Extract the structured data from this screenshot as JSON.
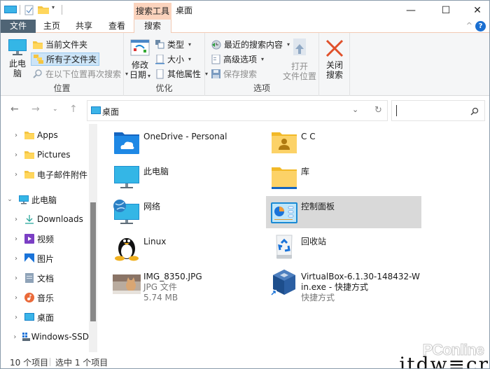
{
  "titlebar": {
    "context_tab": "搜索工具",
    "title": "桌面",
    "minimize": "—",
    "maximize": "☐",
    "close": "✕"
  },
  "tabs": [
    {
      "label": "文件"
    },
    {
      "label": "主页"
    },
    {
      "label": "共享"
    },
    {
      "label": "查看"
    },
    {
      "label": "搜索",
      "active": true
    }
  ],
  "ribbon": {
    "collapse": "^",
    "help": "?",
    "groups": {
      "location": {
        "label": "位置",
        "this_pc": "此电脑",
        "this_pc_line2": "脑",
        "this_pc_line1": "此电",
        "current_folder": "当前文件夹",
        "all_subfolders": "所有子文件夹",
        "search_again": "在以下位置再次搜索"
      },
      "refine": {
        "label": "优化",
        "date_modified_line1": "修改",
        "date_modified_line2": "日期",
        "kind": "类型",
        "size": "大小",
        "other_properties": "其他属性"
      },
      "options": {
        "label": "选项",
        "recent_searches": "最近的搜索内容",
        "advanced_options": "高级选项",
        "save_search": "保存搜索",
        "open_location_line1": "打开",
        "open_location_line2": "文件位置"
      },
      "close": {
        "line1": "关闭",
        "line2": "搜索"
      }
    }
  },
  "address": {
    "path": "桌面",
    "search_placeholder": ""
  },
  "sidebar": {
    "items": [
      {
        "label": "Apps",
        "icon": "folder-icon",
        "expanded": false
      },
      {
        "label": "Pictures",
        "icon": "folder-icon",
        "expanded": false
      },
      {
        "label": "电子邮件附件",
        "icon": "folder-icon",
        "expanded": false
      },
      {
        "label": "此电脑",
        "icon": "computer-icon",
        "expanded": true
      },
      {
        "label": "Downloads",
        "icon": "download-icon",
        "expanded": false
      },
      {
        "label": "视频",
        "icon": "video-icon",
        "expanded": false
      },
      {
        "label": "图片",
        "icon": "picture-icon",
        "expanded": false
      },
      {
        "label": "文档",
        "icon": "document-icon",
        "expanded": false
      },
      {
        "label": "音乐",
        "icon": "music-icon",
        "expanded": false
      },
      {
        "label": "桌面",
        "icon": "desktop-icon",
        "expanded": false
      },
      {
        "label": "Windows-SSD",
        "icon": "drive-icon",
        "expanded": false
      }
    ]
  },
  "content": {
    "items": [
      {
        "name": "OneDrive - Personal",
        "icon": "onedrive-folder-icon"
      },
      {
        "name": "C C",
        "icon": "user-folder-icon"
      },
      {
        "name": "此电脑",
        "icon": "computer-icon"
      },
      {
        "name": "库",
        "icon": "library-folder-icon"
      },
      {
        "name": "网络",
        "icon": "network-icon"
      },
      {
        "name": "控制面板",
        "icon": "control-panel-icon",
        "selected": true
      },
      {
        "name": "Linux",
        "icon": "tux-icon"
      },
      {
        "name": "回收站",
        "icon": "recycle-bin-icon"
      },
      {
        "name": "IMG_8350.JPG",
        "type": "JPG 文件",
        "size": "5.74 MB",
        "icon": "image-thumbnail-icon"
      },
      {
        "name": "VirtualBox-6.1.30-148432-Win.exe - 快捷方式",
        "type": "快捷方式",
        "icon": "virtualbox-icon"
      }
    ]
  },
  "status": {
    "count": "10 个项目",
    "selected": "选中 1 个项目"
  },
  "watermark": {
    "brand": "PConline",
    "text": "itdw≡cr"
  }
}
